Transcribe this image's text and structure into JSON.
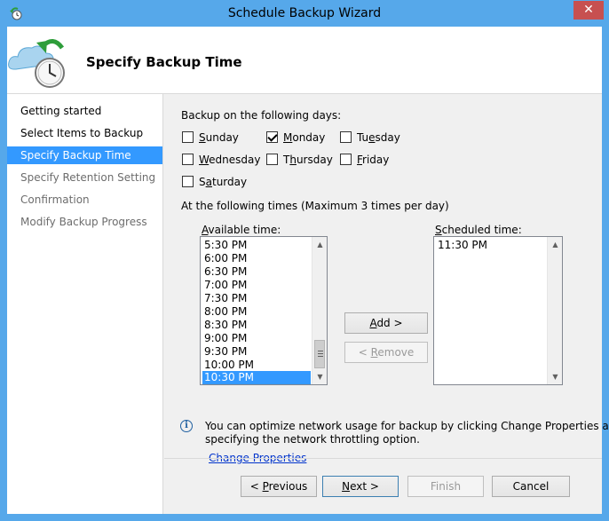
{
  "window": {
    "title": "Schedule Backup Wizard",
    "close_glyph": "✕"
  },
  "header": {
    "title": "Specify Backup Time",
    "icon": "backup-clock-icon"
  },
  "nav": {
    "items": [
      {
        "label": "Getting started",
        "state": "done"
      },
      {
        "label": "Select Items to Backup",
        "state": "done"
      },
      {
        "label": "Specify Backup Time",
        "state": "active"
      },
      {
        "label": "Specify Retention Setting",
        "state": "pending"
      },
      {
        "label": "Confirmation",
        "state": "pending"
      },
      {
        "label": "Modify Backup Progress",
        "state": "pending"
      }
    ]
  },
  "days": {
    "label": "Backup on the following days:",
    "items": [
      {
        "pre": "",
        "key": "S",
        "post": "unday",
        "checked": false
      },
      {
        "pre": "",
        "key": "M",
        "post": "onday",
        "checked": true
      },
      {
        "pre": "Tu",
        "key": "e",
        "post": "sday",
        "checked": false
      },
      {
        "pre": "",
        "key": "W",
        "post": "ednesday",
        "checked": false
      },
      {
        "pre": "T",
        "key": "h",
        "post": "ursday",
        "checked": false
      },
      {
        "pre": "",
        "key": "F",
        "post": "riday",
        "checked": false
      },
      {
        "pre": "S",
        "key": "a",
        "post": "turday",
        "checked": false
      }
    ]
  },
  "times": {
    "label": "At the following times (Maximum 3 times per day)",
    "available_label_pre": "",
    "available_label_key": "A",
    "available_label_post": "vailable time:",
    "available": [
      "5:30 PM",
      "6:00 PM",
      "6:30 PM",
      "7:00 PM",
      "7:30 PM",
      "8:00 PM",
      "8:30 PM",
      "9:00 PM",
      "9:30 PM",
      "10:00 PM",
      "10:30 PM"
    ],
    "selected_available": "10:30 PM",
    "scheduled_label_pre": "",
    "scheduled_label_key": "S",
    "scheduled_label_post": "cheduled time:",
    "scheduled": [
      "11:30 PM"
    ]
  },
  "buttons": {
    "add_key": "A",
    "add_post": "dd >",
    "remove_pre": "< ",
    "remove_key": "R",
    "remove_post": "emove",
    "previous_pre": "< ",
    "previous_key": "P",
    "previous_post": "revious",
    "next_key": "N",
    "next_post": "ext >",
    "finish": "Finish",
    "cancel": "Cancel"
  },
  "info": {
    "text_line1": "You can optimize network usage for backup by clicking Change Properties and",
    "text_line2": "specifying the network throttling option.",
    "link": "Change Properties"
  },
  "colors": {
    "title_bar": "#56a8ea",
    "selection": "#3399ff",
    "close_button": "#c75050",
    "link": "#0033cc"
  }
}
